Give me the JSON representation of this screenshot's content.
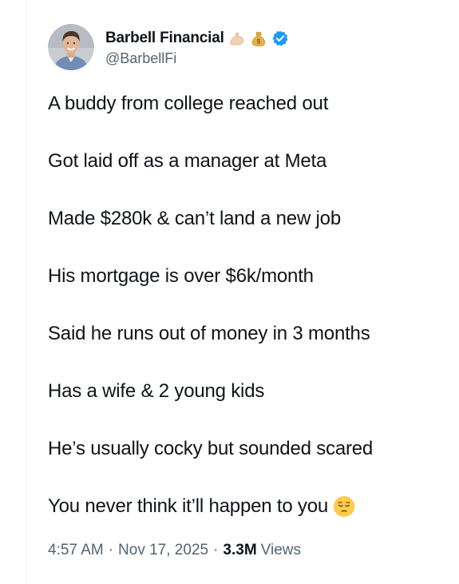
{
  "author": {
    "display_name": "Barbell Financial",
    "handle": "@BarbellFi",
    "name_emojis": [
      "flexed-biceps-icon",
      "money-bag-icon"
    ],
    "verified": true
  },
  "tweet": {
    "lines": [
      "A buddy from college reached out",
      "Got laid off as a manager at Meta",
      "Made $280k & can’t land a new job",
      "His mortgage is over $6k/month",
      "Said he runs out of money in 3 months",
      "Has a wife & 2 young kids",
      "He’s usually cocky but sounded scared",
      "You never think it’ll happen to you"
    ],
    "trailing_emoji": "pensive-face-icon"
  },
  "meta": {
    "time": "4:57 AM",
    "separator": "·",
    "date": "Nov 17, 2025",
    "views_count": "3.3M",
    "views_label": "Views"
  },
  "colors": {
    "text_primary": "#0f1419",
    "text_secondary": "#536471",
    "verified_blue": "#1d9bf0",
    "border": "#eff3f4"
  }
}
